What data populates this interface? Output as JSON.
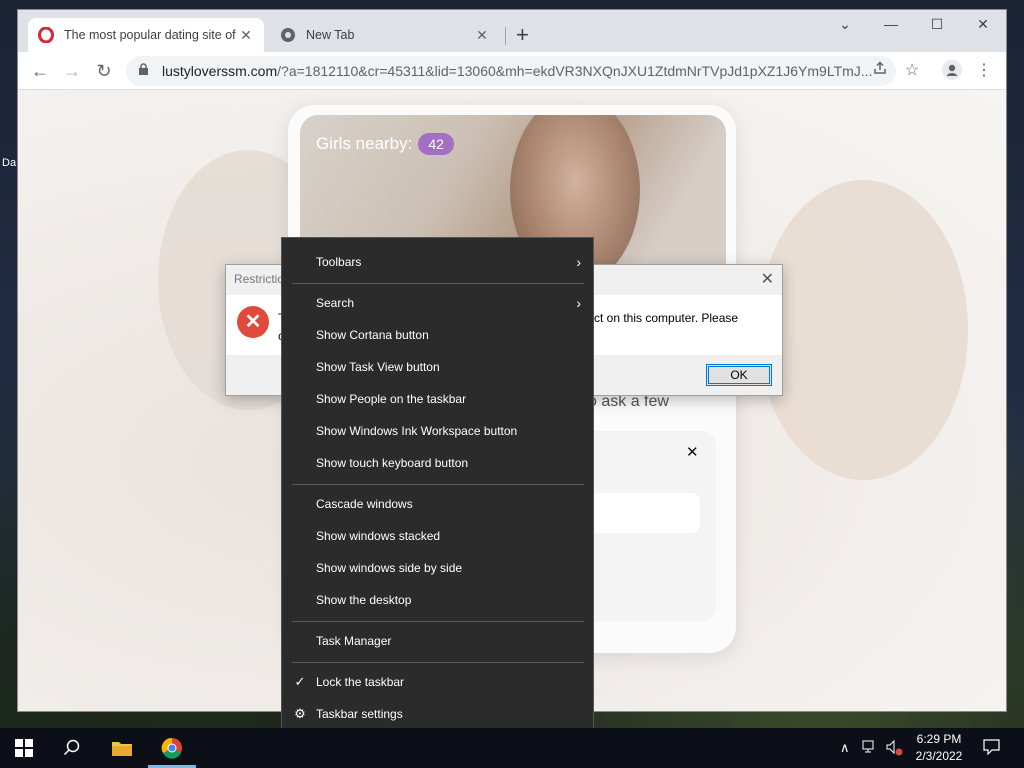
{
  "desktop": {
    "icon_label": "Da"
  },
  "browser": {
    "tabs": [
      {
        "title": "The most popular dating site of t",
        "close": "✕"
      },
      {
        "title": "New Tab",
        "close": "✕"
      }
    ],
    "new_tab": "+",
    "window_controls": {
      "collapse": "⌄",
      "minimize": "—",
      "maximize": "☐",
      "close": "✕"
    },
    "nav": {
      "back": "←",
      "forward": "→",
      "reload": "↻"
    },
    "address": {
      "host": "lustyloverssm.com",
      "path": "/?a=1812110&cr=45311&lid=13060&mh=ekdVR3NXQnJXU1ZtdmNrTVpJd1pXZ1J6Ym9LTmJ..."
    }
  },
  "page": {
    "girls_nearby_label": "Girls nearby:",
    "girls_nearby_count": "42",
    "ask_text": "o ask a few",
    "question_close": "✕"
  },
  "dialog": {
    "title": "Restrictio",
    "close": "✕",
    "message_left": "T",
    "message_left2": "c",
    "message": "ct on this computer. Please",
    "ok_label": "OK"
  },
  "context_menu": {
    "items": [
      {
        "label": "Toolbars",
        "submenu": true
      },
      {
        "label": "Search",
        "submenu": true
      },
      {
        "label": "Show Cortana button"
      },
      {
        "label": "Show Task View button"
      },
      {
        "label": "Show People on the taskbar"
      },
      {
        "label": "Show Windows Ink Workspace button"
      },
      {
        "label": "Show touch keyboard button"
      },
      {
        "label": "Cascade windows"
      },
      {
        "label": "Show windows stacked"
      },
      {
        "label": "Show windows side by side"
      },
      {
        "label": "Show the desktop"
      },
      {
        "label": "Task Manager"
      },
      {
        "label": "Lock the taskbar",
        "checked": true
      },
      {
        "label": "Taskbar settings",
        "icon": "gear-icon"
      }
    ]
  },
  "taskbar": {
    "clock_time": "6:29 PM",
    "clock_date": "2/3/2022"
  },
  "colors": {
    "accent": "#0078d7",
    "badge": "#a36fc4",
    "error": "#e04a3a",
    "menu_bg": "#2b2b2b"
  }
}
